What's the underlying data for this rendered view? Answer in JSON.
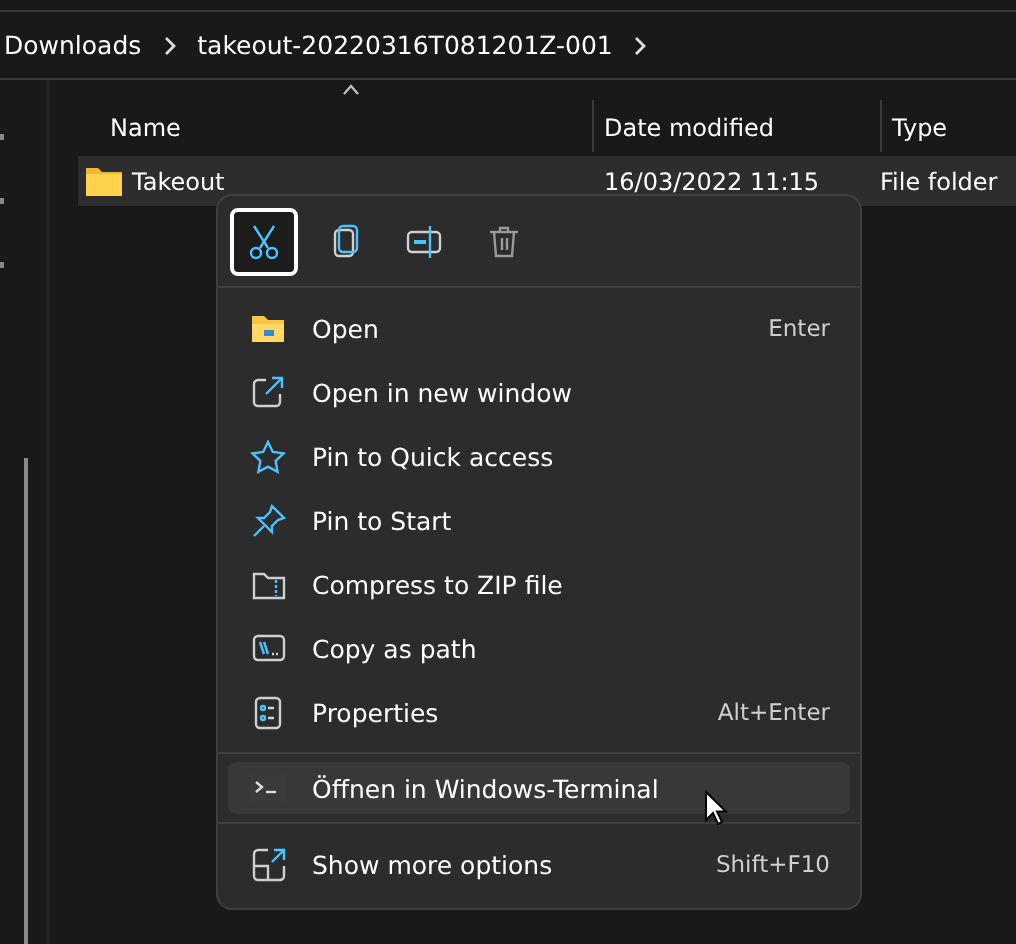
{
  "breadcrumb": [
    {
      "label": "Downloads"
    },
    {
      "label": "takeout-20220316T081201Z-001"
    }
  ],
  "columns": [
    {
      "label": "Name",
      "sorted": true
    },
    {
      "label": "Date modified",
      "sorted": false
    },
    {
      "label": "Type",
      "sorted": false
    }
  ],
  "rows": [
    {
      "name": "Takeout",
      "date": "16/03/2022 11:15",
      "type": "File folder",
      "selected": true
    }
  ],
  "menu": {
    "toolbar": [
      {
        "kind": "cut",
        "selected": true
      },
      {
        "kind": "copy",
        "selected": false
      },
      {
        "kind": "rename",
        "selected": false
      },
      {
        "kind": "delete",
        "selected": false
      }
    ],
    "groups": [
      [
        {
          "kind": "open",
          "label": "Open",
          "shortcut": "Enter",
          "hovered": false
        },
        {
          "kind": "newwindow",
          "label": "Open in new window",
          "hovered": false
        },
        {
          "kind": "star",
          "label": "Pin to Quick access",
          "hovered": false
        },
        {
          "kind": "pin",
          "label": "Pin to Start",
          "hovered": false
        },
        {
          "kind": "zip",
          "label": "Compress to ZIP file",
          "hovered": false
        },
        {
          "kind": "path",
          "label": "Copy as path",
          "hovered": false
        },
        {
          "kind": "props",
          "label": "Properties",
          "shortcut": "Alt+Enter",
          "hovered": false
        }
      ],
      [
        {
          "kind": "terminal",
          "label": "Öffnen in Windows-Terminal",
          "hovered": true
        }
      ],
      [
        {
          "kind": "more",
          "label": "Show more options",
          "shortcut": "Shift+F10",
          "hovered": false
        }
      ]
    ]
  }
}
